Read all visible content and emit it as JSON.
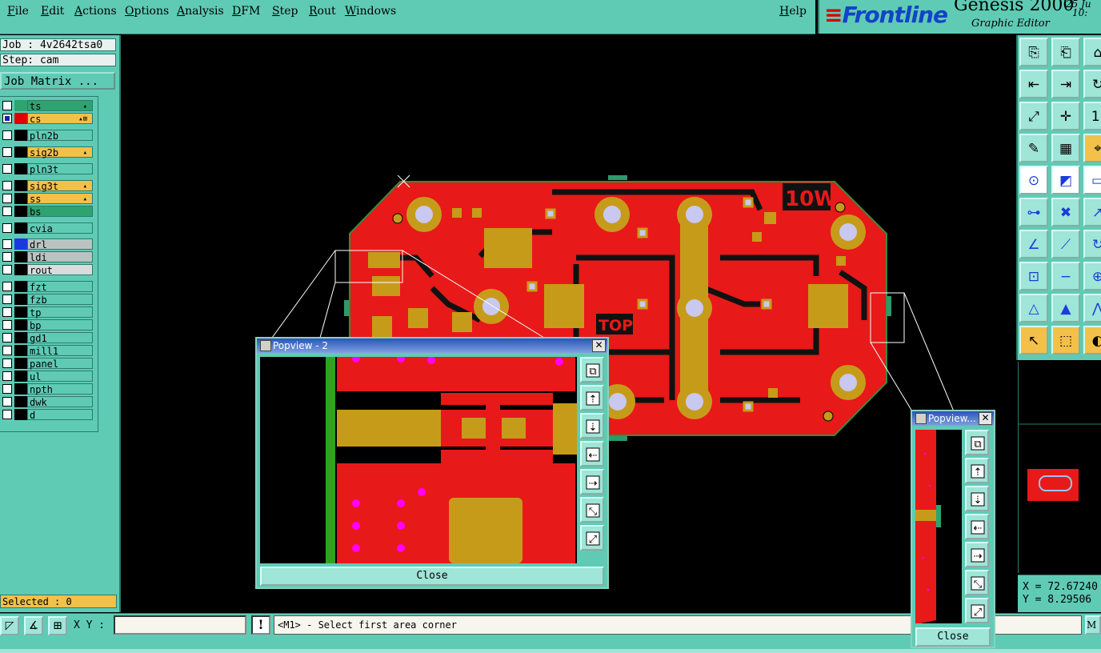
{
  "menu": {
    "items": [
      "File",
      "Edit",
      "Actions",
      "Options",
      "Analysis",
      "DFM",
      "Step",
      "Rout",
      "Windows"
    ],
    "help": "Help"
  },
  "brand": {
    "logo": "Frontline",
    "title": "Genesis 2000",
    "subtitle": "Graphic Editor",
    "date": "25 Ju",
    "time": "10:"
  },
  "job": {
    "job_line": "Job : 4v2642tsa0",
    "step_line": "Step: cam",
    "matrix_button": "Job Matrix ..."
  },
  "layers": [
    {
      "name": "ts",
      "color": "#2fa36f",
      "swatch": "#2fa36f",
      "checked": false,
      "icon": "▴"
    },
    {
      "name": "cs",
      "color": "#f3c04a",
      "swatch": "#e00000",
      "checked": true,
      "icon": "▴⊞"
    },
    {
      "name": "pln2b",
      "color": "#5fcbb5",
      "swatch": "#000000",
      "checked": false,
      "icon": ""
    },
    {
      "name": "sig2b",
      "color": "#f3c04a",
      "swatch": "#000000",
      "checked": false,
      "icon": "▴"
    },
    {
      "name": "pln3t",
      "color": "#5fcbb5",
      "swatch": "#000000",
      "checked": false,
      "icon": ""
    },
    {
      "name": "sig3t",
      "color": "#f3c04a",
      "swatch": "#000000",
      "checked": false,
      "icon": "▴"
    },
    {
      "name": "ss",
      "color": "#f3c04a",
      "swatch": "#000000",
      "checked": false,
      "icon": "▴"
    },
    {
      "name": "bs",
      "color": "#2fa36f",
      "swatch": "#000000",
      "checked": false,
      "icon": ""
    },
    {
      "name": "cvia",
      "color": "#5fcbb5",
      "swatch": "#000000",
      "checked": false,
      "icon": ""
    },
    {
      "name": "drl",
      "color": "#b9c4c2",
      "swatch": "#1a3ae0",
      "checked": false,
      "icon": ""
    },
    {
      "name": "ldi",
      "color": "#b9c4c2",
      "swatch": "#000000",
      "checked": false,
      "icon": ""
    },
    {
      "name": "rout",
      "color": "#d9dcdc",
      "swatch": "#000000",
      "checked": false,
      "icon": ""
    },
    {
      "name": "fzt",
      "color": "#5fcbb5",
      "swatch": "#000000",
      "checked": false,
      "icon": ""
    },
    {
      "name": "fzb",
      "color": "#5fcbb5",
      "swatch": "#000000",
      "checked": false,
      "icon": ""
    },
    {
      "name": "tp",
      "color": "#5fcbb5",
      "swatch": "#000000",
      "checked": false,
      "icon": ""
    },
    {
      "name": "bp",
      "color": "#5fcbb5",
      "swatch": "#000000",
      "checked": false,
      "icon": ""
    },
    {
      "name": "gd1",
      "color": "#5fcbb5",
      "swatch": "#000000",
      "checked": false,
      "icon": ""
    },
    {
      "name": "mill1",
      "color": "#5fcbb5",
      "swatch": "#000000",
      "checked": false,
      "icon": ""
    },
    {
      "name": "panel",
      "color": "#5fcbb5",
      "swatch": "#000000",
      "checked": false,
      "icon": ""
    },
    {
      "name": "ul",
      "color": "#5fcbb5",
      "swatch": "#000000",
      "checked": false,
      "icon": ""
    },
    {
      "name": "npth",
      "color": "#5fcbb5",
      "swatch": "#000000",
      "checked": false,
      "icon": ""
    },
    {
      "name": "dwk",
      "color": "#5fcbb5",
      "swatch": "#000000",
      "checked": false,
      "icon": ""
    },
    {
      "name": "d",
      "color": "#5fcbb5",
      "swatch": "#000000",
      "checked": false,
      "icon": ""
    }
  ],
  "selected": "Selected : 0",
  "bottom": {
    "xy_label": "X Y :",
    "xy_value": "",
    "excl": "!",
    "message": "<M1> - Select first area corner",
    "m_button": "M"
  },
  "coords": {
    "x": "X = 72.67240",
    "y": "Y = 8.29506"
  },
  "board": {
    "label_10w": "10W",
    "label_top": "TOP"
  },
  "popview1": {
    "title": "Popview - 2",
    "close": "Close"
  },
  "popview2": {
    "title": "Popview...",
    "close": "Close"
  },
  "icons": {
    "right_toolbar": [
      "copy-icon",
      "paste-icon",
      "home-icon",
      "move-left-icon",
      "move-right-icon",
      "redo-icon",
      "fit-icon",
      "center-icon",
      "scale-icon",
      "measure-icon",
      "grid-icon",
      "snap-icon",
      "pin-icon",
      "netlist-icon",
      "ruler-icon",
      "connect-icon",
      "cross-icon",
      "arrow-icon",
      "draw-line-icon",
      "edit-line-icon",
      "rotate-icon",
      "point-icon",
      "minus-icon",
      "plus-icon",
      "triangle-icon",
      "triangle-fill-icon",
      "angle-icon",
      "select-arrow-icon",
      "select-area-icon",
      "zoom-select-icon"
    ],
    "popview_tools": [
      "zoom-window-icon",
      "pan-up-icon",
      "pan-down-icon",
      "pan-left-icon",
      "pan-right-icon",
      "zoom-out-icon",
      "zoom-in-icon"
    ]
  }
}
